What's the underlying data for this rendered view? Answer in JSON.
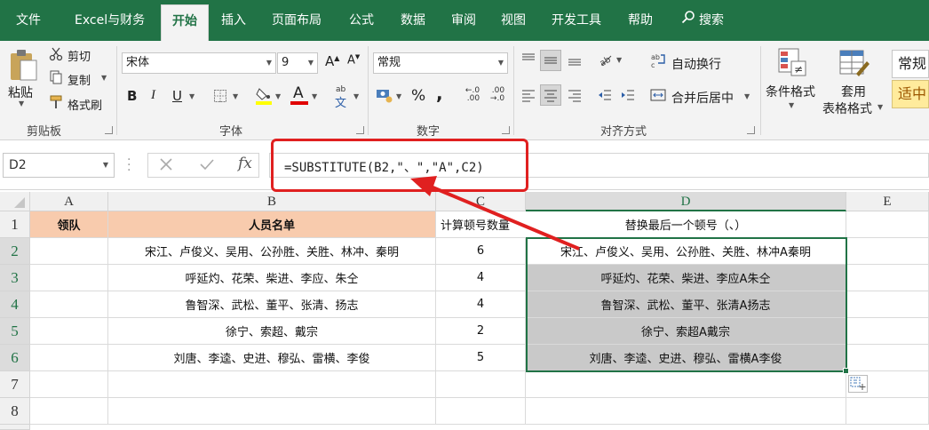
{
  "ribbon_tabs": [
    "文件",
    "Excel与财务",
    "开始",
    "插入",
    "页面布局",
    "公式",
    "数据",
    "审阅",
    "视图",
    "开发工具",
    "帮助",
    "搜索"
  ],
  "clipboard": {
    "paste": "粘贴",
    "cut": "剪切",
    "copy": "复制",
    "format_painter": "格式刷",
    "group": "剪贴板"
  },
  "font": {
    "name": "宋体",
    "size": "9",
    "grow": "A",
    "shrink": "A",
    "bold": "B",
    "italic": "I",
    "underline": "U",
    "color_letter": "A",
    "phonetic": "文",
    "group": "字体"
  },
  "number": {
    "format": "常规",
    "percent": "%",
    "comma": ",",
    "group": "数字"
  },
  "alignment": {
    "wrap": "自动换行",
    "merge": "合并后居中",
    "group": "对齐方式"
  },
  "styles": {
    "conditional_1": "条件格式",
    "table_1": "套用",
    "table_2": "表格格式",
    "style_normal": "常规",
    "style_neutral": "适中"
  },
  "namebox": "D2",
  "formula": "=SUBSTITUTE(B2,\"、\",\"A\",C2)",
  "columns": [
    "A",
    "B",
    "C",
    "D",
    "E"
  ],
  "rows": [
    "1",
    "2",
    "3",
    "4",
    "5",
    "6",
    "7",
    "8"
  ],
  "header": [
    "领队",
    "人员名单",
    "计算顿号数量",
    "替换最后一个顿号（、）"
  ],
  "data_rows": [
    {
      "b": "宋江、卢俊义、吴用、公孙胜、关胜、林冲、秦明",
      "c": "6",
      "d": "宋江、卢俊义、吴用、公孙胜、关胜、林冲A秦明"
    },
    {
      "b": "呼延灼、花荣、柴进、李应、朱仝",
      "c": "4",
      "d": "呼延灼、花荣、柴进、李应A朱仝"
    },
    {
      "b": "鲁智深、武松、董平、张清、扬志",
      "c": "4",
      "d": "鲁智深、武松、董平、张清A扬志"
    },
    {
      "b": "徐宁、索超、戴宗",
      "c": "2",
      "d": "徐宁、索超A戴宗"
    },
    {
      "b": "刘唐、李逵、史进、穆弘、雷横、李俊",
      "c": "5",
      "d": "刘唐、李逵、史进、穆弘、雷横A李俊"
    }
  ],
  "colors": {
    "excel_green": "#217346",
    "header_fill": "#f8cbad",
    "result_fill": "#c9c9c9",
    "annotation_red": "#e02020"
  }
}
